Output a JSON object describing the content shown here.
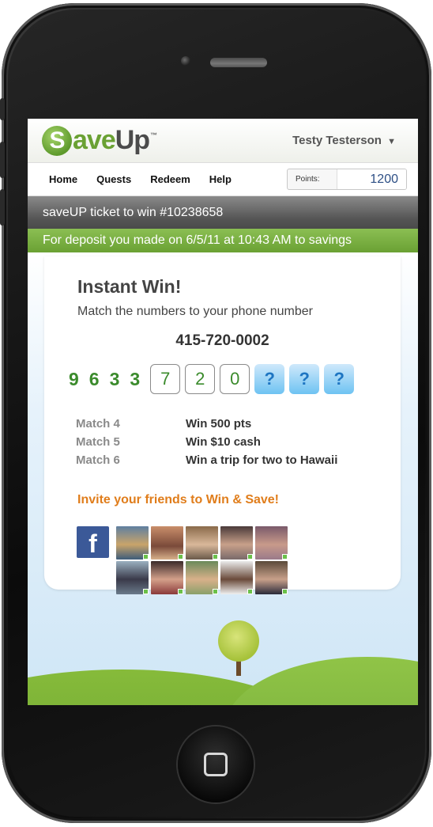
{
  "app": {
    "logo_text_save": "ave",
    "logo_text_up": "Up",
    "logo_letter": "S",
    "logo_tm": "™",
    "user_name": "Testy Testerson",
    "user_caret": "▼"
  },
  "nav": {
    "items": [
      "Home",
      "Quests",
      "Redeem",
      "Help"
    ],
    "points_label": "Points:",
    "points_value": "1200"
  },
  "ticket": {
    "title": "saveUP ticket to win #10238658",
    "deposit": "For deposit you made on 6/5/11 at 10:43 AM to savings"
  },
  "game": {
    "title": "Instant Win!",
    "subtitle": "Match the numbers to your phone number",
    "phone_number": "415-720-0002",
    "plain_digits": [
      "9",
      "6",
      "3",
      "3"
    ],
    "box_digits": [
      "7",
      "2",
      "0"
    ],
    "hidden_digits": [
      "?",
      "?",
      "?"
    ]
  },
  "prizes": [
    {
      "match": "Match 4",
      "win": "Win 500 pts"
    },
    {
      "match": "Match 5",
      "win": "Win $10 cash"
    },
    {
      "match": "Match 6",
      "win": "Win a trip for two to Hawaii"
    }
  ],
  "invite": {
    "title": "Invite your friends to Win & Save!",
    "fb_letter": "f"
  },
  "colors": {
    "brand_green": "#6aa133",
    "accent_orange": "#e07d1b",
    "facebook_blue": "#3b5998",
    "digit_green": "#3b8b2c"
  }
}
